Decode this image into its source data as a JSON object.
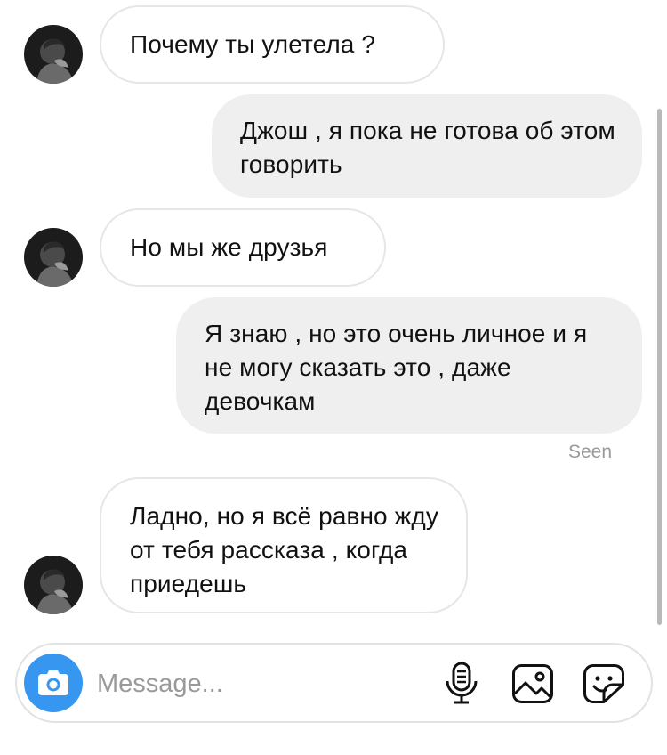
{
  "thread": {
    "messages": [
      {
        "direction": "incoming",
        "text": "Почему ты улетела ?"
      },
      {
        "direction": "outgoing",
        "text": "Джош , я пока не готова об этом говорить"
      },
      {
        "direction": "incoming",
        "text": "Но мы же друзья"
      },
      {
        "direction": "outgoing",
        "text": "Я знаю , но это очень личное и я не могу сказать это , даже девочкам"
      },
      {
        "direction": "incoming",
        "text": "Ладно, но я всё равно жду от тебя рассказа , когда приедешь"
      }
    ],
    "seen_label": "Seen"
  },
  "composer": {
    "placeholder": "Message...",
    "value": "",
    "icons": [
      "camera-icon",
      "microphone-icon",
      "gallery-icon",
      "sticker-icon"
    ]
  },
  "colors": {
    "accent": "#3797f0",
    "outgoing_bubble": "#efefef",
    "incoming_border": "#e6e6e6",
    "muted_text": "#9a9a9a"
  }
}
